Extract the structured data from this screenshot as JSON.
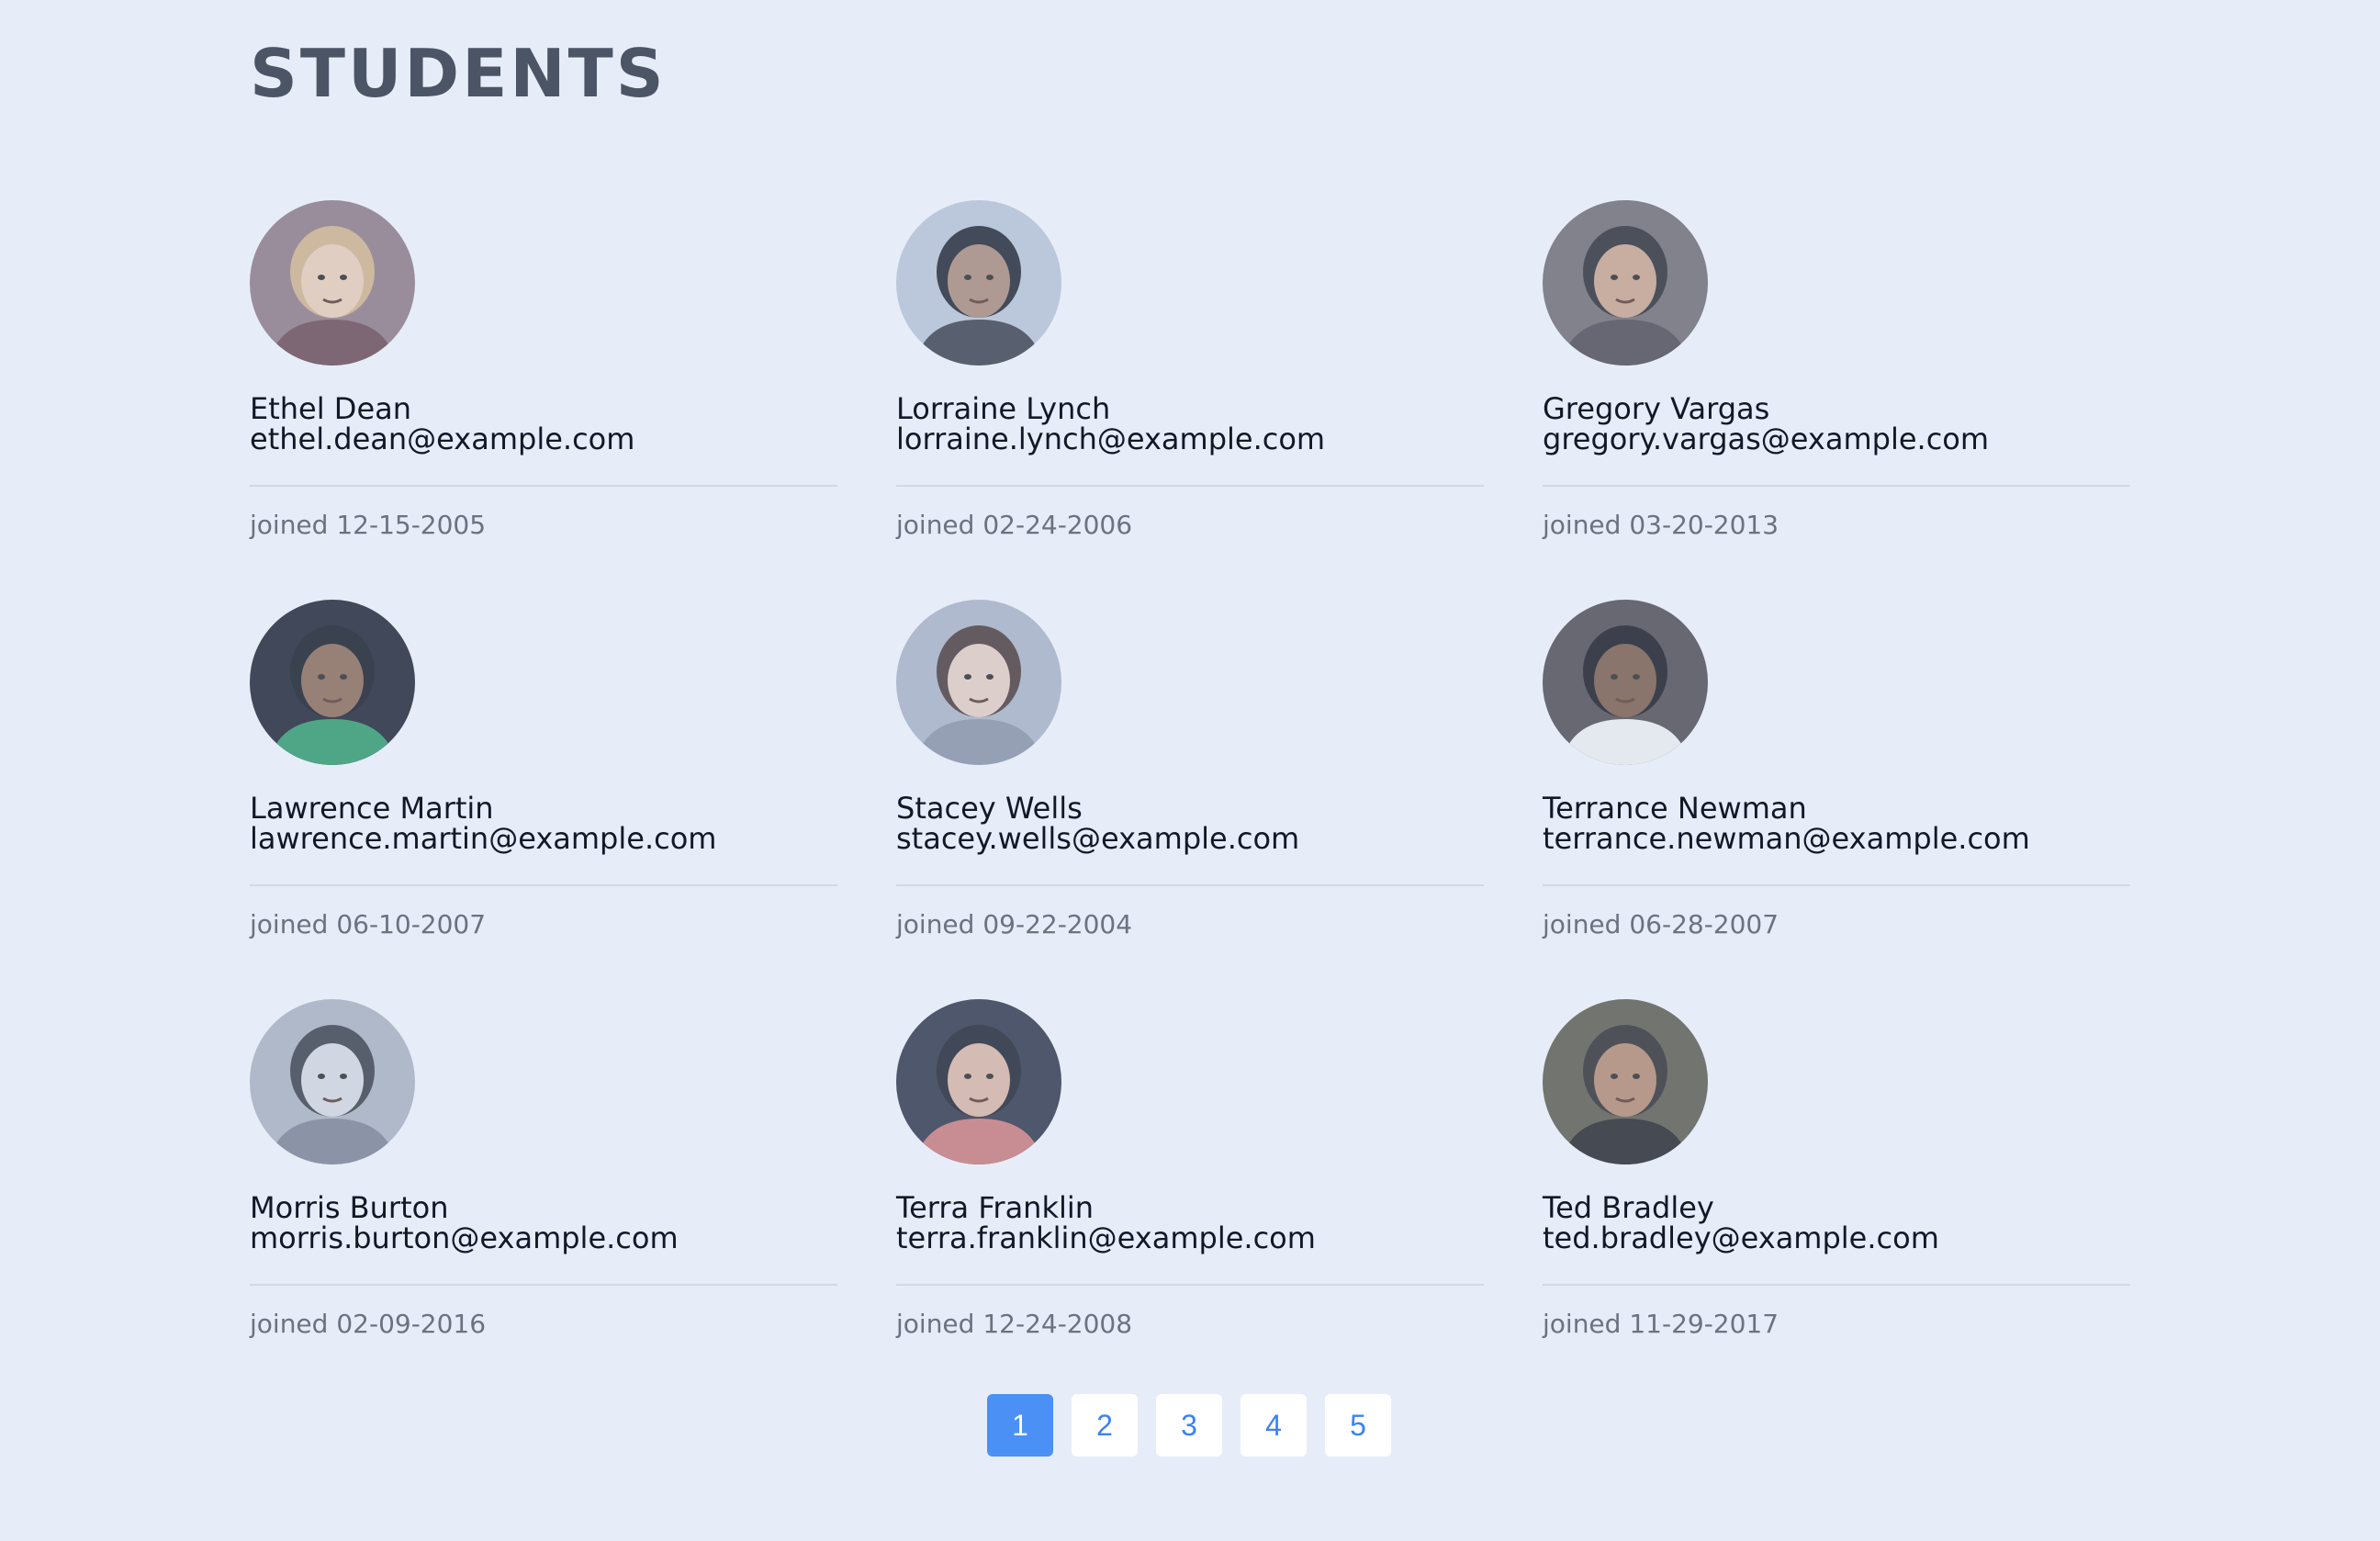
{
  "page": {
    "title": "STUDENTS"
  },
  "students": [
    {
      "name": "Ethel Dean",
      "email": "ethel.dean@example.com",
      "joined": "joined 12-15-2005",
      "avatar": {
        "bg": "#8f7a86",
        "skin": "#e9cdb8",
        "hair": "#cfb38c",
        "shirt": "#6b4a55"
      }
    },
    {
      "name": "Lorraine Lynch",
      "email": "lorraine.lynch@example.com",
      "joined": "joined 02-24-2006",
      "avatar": {
        "bg": "#b9c6d8",
        "skin": "#a98b7b",
        "hair": "#1f2433",
        "shirt": "#3a3f4d"
      }
    },
    {
      "name": "Gregory Vargas",
      "email": "gregory.vargas@example.com",
      "joined": "joined 03-20-2013",
      "avatar": {
        "bg": "#6f6c72",
        "skin": "#caa38e",
        "hair": "#2a2c33",
        "shirt": "#4e4a52"
      }
    },
    {
      "name": "Lawrence Martin",
      "email": "lawrence.martin@example.com",
      "joined": "joined 06-10-2007",
      "avatar": {
        "bg": "#1b2233",
        "skin": "#8b6a57",
        "hair": "#151a24",
        "shirt": "#2f9a6b"
      }
    },
    {
      "name": "Stacey Wells",
      "email": "stacey.wells@example.com",
      "joined": "joined 09-22-2004",
      "avatar": {
        "bg": "#a9b4c7",
        "skin": "#e3cdc3",
        "hair": "#4a3a3a",
        "shirt": "#8a93a6"
      }
    },
    {
      "name": "Terrance Newman",
      "email": "terrance.newman@example.com",
      "joined": "joined 06-28-2007",
      "avatar": {
        "bg": "#4e4b50",
        "skin": "#7a5b49",
        "hair": "#161820",
        "shirt": "#eef0f3"
      }
    },
    {
      "name": "Morris Burton",
      "email": "morris.burton@example.com",
      "joined": "joined 02-09-2016",
      "avatar": {
        "bg": "#aab3c2",
        "skin": "#d4d8e0",
        "hair": "#3a3f4a",
        "shirt": "#7b8394"
      }
    },
    {
      "name": "Terra Franklin",
      "email": "terra.franklin@example.com",
      "joined": "joined 12-24-2008",
      "avatar": {
        "bg": "#2e3548",
        "skin": "#d9b5a5",
        "hair": "#1d2230",
        "shirt": "#c97a7a"
      }
    },
    {
      "name": "Ted Bradley",
      "email": "ted.bradley@example.com",
      "joined": "joined 11-29-2017",
      "avatar": {
        "bg": "#5b5c4e",
        "skin": "#b48a73",
        "hair": "#2f2e31",
        "shirt": "#232428"
      }
    }
  ],
  "pagination": {
    "pages": [
      "1",
      "2",
      "3",
      "4",
      "5"
    ],
    "current": "1"
  }
}
